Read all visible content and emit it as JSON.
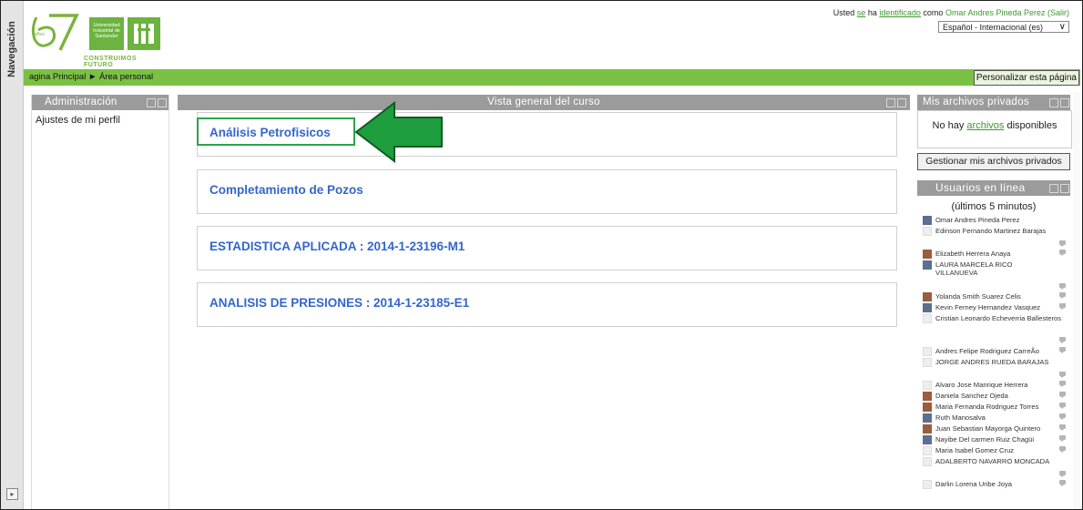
{
  "nav": {
    "label": "Navegación",
    "dock_icon": "dock-icon"
  },
  "header": {
    "logo_number": "57",
    "logo_years": "años",
    "university_name": "Universidad Industrial de Santander",
    "logo_tagline": "CONSTRUIMOS FUTURO",
    "login_prefix": "Usted",
    "login_se": "se",
    "login_ha": "ha",
    "login_identificado": "identificado",
    "login_como": "como",
    "login_user": "Omar Andres Pineda Perez (Salir)",
    "language": "Español - Internacional (es)"
  },
  "breadcrumb": {
    "text": "agina Principal ► Área personal",
    "customize_button": "Personalizar esta página"
  },
  "admin_block": {
    "title": "Administración",
    "items": [
      "Ajustes de mi perfil"
    ]
  },
  "course_overview": {
    "title": "Vista general del curso",
    "courses": [
      {
        "name": "Análisis Petrofisicos"
      },
      {
        "name": "Completamiento de Pozos"
      },
      {
        "name": "ESTADISTICA APLICADA : 2014-1-23196-M1"
      },
      {
        "name": "ANALISIS DE PRESIONES : 2014-1-23185-E1"
      }
    ]
  },
  "private_files": {
    "title": "Mis archivos privados",
    "no_files_before": "No hay",
    "no_files_link": "archivos",
    "no_files_after": "disponibles",
    "manage_button": "Gestionar mis archivos privados"
  },
  "online_users": {
    "title": "Usuarios en línea",
    "subtitle": "(últimos 5 minutos)",
    "users": [
      "Omar Andres Pineda Perez",
      "Edinson Fernando Martinez Barajas",
      "Elizabeth Herrera Anaya",
      "LAURA MARCELA RICO VILLANUEVA",
      "Yolanda Smith Suarez Celis",
      "Kevin Ferney Hernandez Vasquez",
      "Cristian Leonardo Echeverria Ballesteros",
      "Andres Felipe Rodriguez CarreÃo",
      "JORGE ANDRES RUEDA BARAJAS",
      "Alvaro Jose Manrique Herrera",
      "Daniela Sanchez Ojeda",
      "Maria Fernanda Rodriguez Torres",
      "Ruth Manosalva",
      "Juan Sebastian Mayorga Quintero",
      "Nayibe Del carmen Ruiz Chagüi",
      "Maria Isabel Gomez Cruz",
      "ADALBERTO NAVARRO MONCADA",
      "Darlin Lorena Uribe Joya"
    ]
  },
  "colors": {
    "accent_green": "#7ac143",
    "link_blue": "#3366cc",
    "highlight_green": "#2ea24a",
    "block_header_gray": "#9b9b9b"
  }
}
